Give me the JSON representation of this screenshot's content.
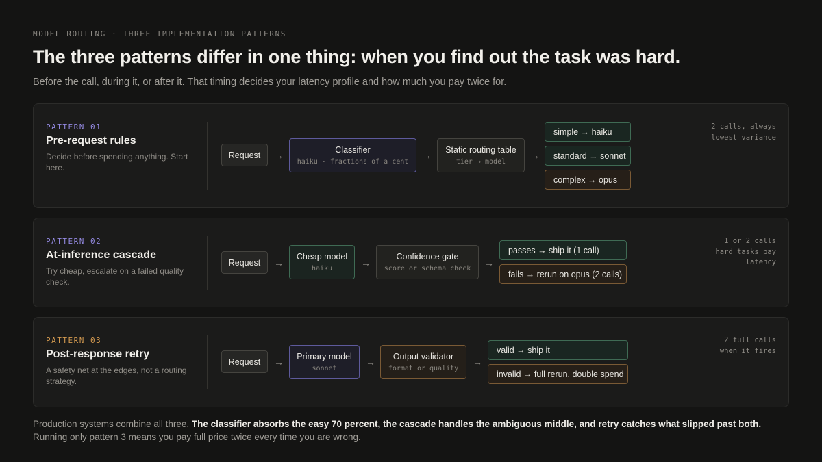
{
  "eyebrow": "MODEL ROUTING · THREE IMPLEMENTATION PATTERNS",
  "title": "The three patterns differ in one thing: when you find out the task was hard.",
  "subtitle": "Before the call, during it, or after it. That timing decides your latency profile and how much you pay twice for.",
  "arrow_glyph": "→",
  "patterns": [
    {
      "label": "PATTERN 01",
      "name": "Pre-request rules",
      "desc": "Decide before spending anything. Start here.",
      "request": "Request",
      "step1": {
        "label": "Classifier",
        "sub": "haiku · fractions of a cent"
      },
      "step2": {
        "label": "Static routing table",
        "sub": "tier → model"
      },
      "outcomes": [
        "simple → haiku",
        "standard → sonnet",
        "complex → opus"
      ],
      "note": [
        "2 calls, always",
        "lowest variance"
      ]
    },
    {
      "label": "PATTERN 02",
      "name": "At-inference cascade",
      "desc": "Try cheap, escalate on a failed quality check.",
      "request": "Request",
      "step1": {
        "label": "Cheap model",
        "sub": "haiku"
      },
      "step2": {
        "label": "Confidence gate",
        "sub": "score or schema check"
      },
      "outcomes": [
        "passes → ship it (1 call)",
        "fails → rerun on opus (2 calls)"
      ],
      "note": [
        "1 or 2 calls",
        "hard tasks pay",
        "latency"
      ]
    },
    {
      "label": "PATTERN 03",
      "name": "Post-response retry",
      "desc": "A safety net at the edges, not a routing strategy.",
      "request": "Request",
      "step1": {
        "label": "Primary model",
        "sub": "sonnet"
      },
      "step2": {
        "label": "Output validator",
        "sub": "format or quality"
      },
      "outcomes": [
        "valid → ship it",
        "invalid → full rerun, double spend"
      ],
      "note": [
        "2 full calls",
        "when it fires"
      ]
    }
  ],
  "footer": {
    "lead": "Production systems combine all three.",
    "bold": "The classifier absorbs the easy 70 percent, the cascade handles the ambiguous middle, and retry catches what slipped past both.",
    "tail": "Running only pattern 3 means you pay full price twice every time you are wrong."
  },
  "colors": {
    "background": "#141413",
    "card": "#1b1b1a",
    "accent_violet": "#9389e0",
    "accent_amber": "#d49a50",
    "success_green": "#3f6b54",
    "warning_amber": "#7a5a35"
  }
}
